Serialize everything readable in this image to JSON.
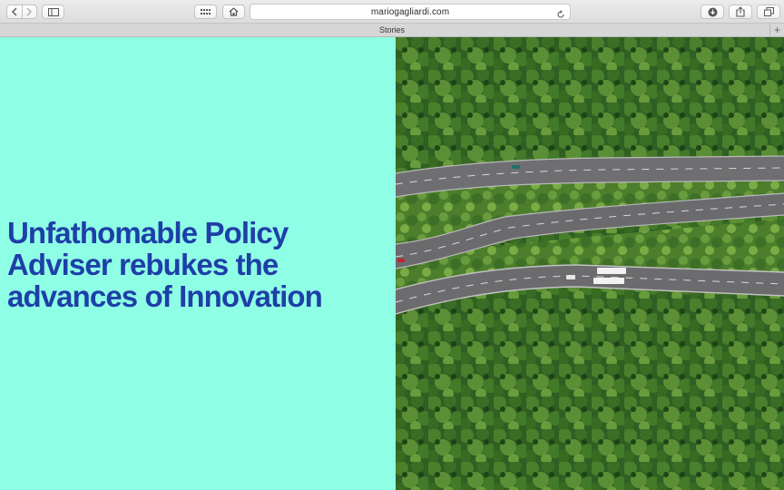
{
  "browser": {
    "url": "mariogagliardi.com",
    "tab_title": "Stories",
    "new_tab_label": "+"
  },
  "page": {
    "headline": "Unfathomable Policy Adviser rebukes the advances of Innovation",
    "panel_color": "#8effe5",
    "headline_color": "#1e3fa8"
  },
  "icons": {
    "back": "chevron-left-icon",
    "forward": "chevron-right-icon",
    "sidebar": "sidebar-icon",
    "top_sites": "grid-icon",
    "home": "home-icon",
    "reload": "reload-icon",
    "downloads": "download-icon",
    "share": "share-icon",
    "tabs": "tabs-overview-icon"
  }
}
